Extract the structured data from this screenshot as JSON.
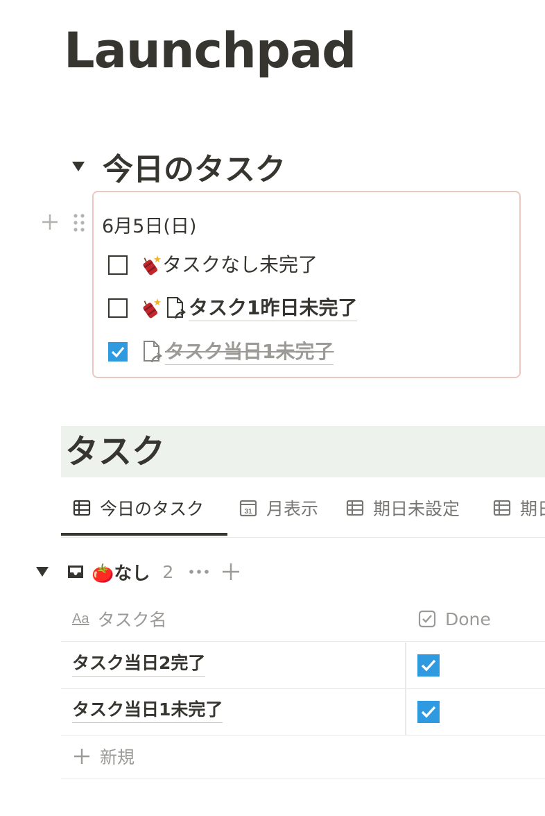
{
  "page": {
    "title": "Launchpad"
  },
  "today_section": {
    "heading": "今日のタスク",
    "date": "6月5日(日)",
    "tasks": [
      {
        "label": "タスクなし未完了",
        "done": false,
        "icons": [
          "firecracker-icon"
        ]
      },
      {
        "label": "タスク1昨日未完了",
        "done": false,
        "icons": [
          "firecracker-icon",
          "page-link-icon"
        ]
      },
      {
        "label": "タスク当日1未完了",
        "done": true,
        "icons": [
          "page-link-icon"
        ]
      }
    ]
  },
  "tasks_db": {
    "heading": "タスク",
    "tabs": [
      {
        "label": "今日のタスク",
        "icon": "table-icon",
        "active": true
      },
      {
        "label": "月表示",
        "icon": "calendar-icon",
        "active": false
      },
      {
        "label": "期日未設定",
        "icon": "table-icon",
        "active": false
      },
      {
        "label": "期日",
        "icon": "table-icon",
        "active": false
      }
    ],
    "group": {
      "name": "🍅なし",
      "count": "2",
      "icon": "inbox-icon"
    },
    "columns": {
      "name": "タスク名",
      "done": "Done",
      "name_icon": "Aa"
    },
    "rows": [
      {
        "name": "タスク当日2完了",
        "done": true
      },
      {
        "name": "タスク当日1未完了",
        "done": true
      }
    ],
    "new_label": "新規"
  },
  "colors": {
    "text": "#37352f",
    "muted": "#9b9a97",
    "checkbox_blue": "#2f9ae0",
    "callout_border": "#ecc7c1",
    "heading_bg": "#edf3ec"
  }
}
